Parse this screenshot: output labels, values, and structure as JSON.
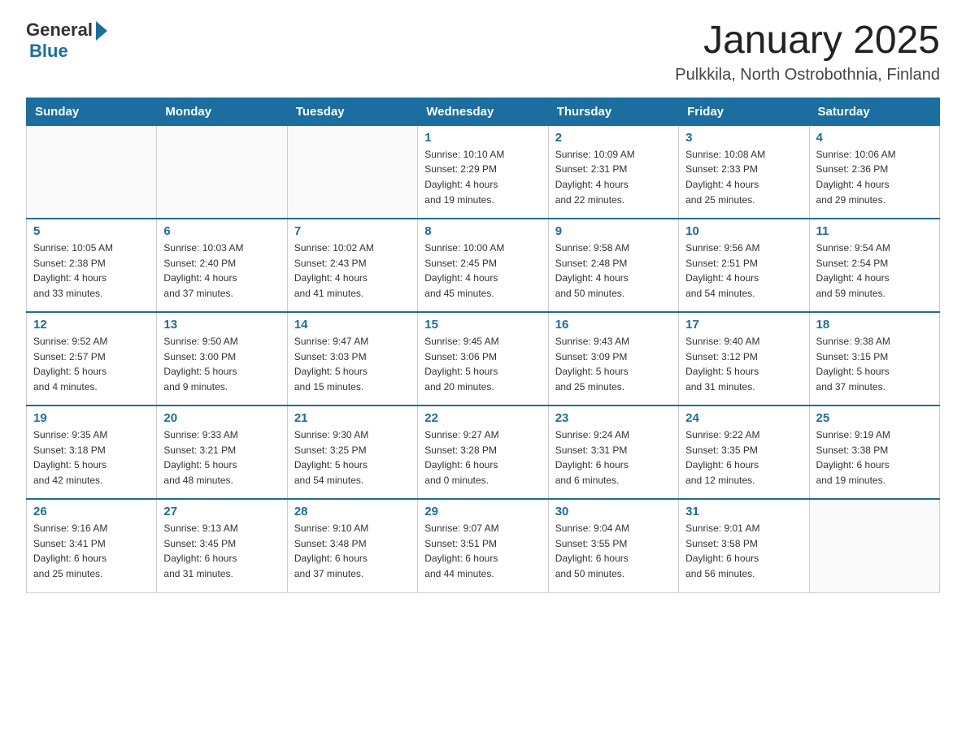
{
  "header": {
    "logo": {
      "general": "General",
      "blue": "Blue"
    },
    "title": "January 2025",
    "subtitle": "Pulkkila, North Ostrobothnia, Finland"
  },
  "weekdays": [
    "Sunday",
    "Monday",
    "Tuesday",
    "Wednesday",
    "Thursday",
    "Friday",
    "Saturday"
  ],
  "weeks": [
    [
      {
        "day": "",
        "info": ""
      },
      {
        "day": "",
        "info": ""
      },
      {
        "day": "",
        "info": ""
      },
      {
        "day": "1",
        "info": "Sunrise: 10:10 AM\nSunset: 2:29 PM\nDaylight: 4 hours\nand 19 minutes."
      },
      {
        "day": "2",
        "info": "Sunrise: 10:09 AM\nSunset: 2:31 PM\nDaylight: 4 hours\nand 22 minutes."
      },
      {
        "day": "3",
        "info": "Sunrise: 10:08 AM\nSunset: 2:33 PM\nDaylight: 4 hours\nand 25 minutes."
      },
      {
        "day": "4",
        "info": "Sunrise: 10:06 AM\nSunset: 2:36 PM\nDaylight: 4 hours\nand 29 minutes."
      }
    ],
    [
      {
        "day": "5",
        "info": "Sunrise: 10:05 AM\nSunset: 2:38 PM\nDaylight: 4 hours\nand 33 minutes."
      },
      {
        "day": "6",
        "info": "Sunrise: 10:03 AM\nSunset: 2:40 PM\nDaylight: 4 hours\nand 37 minutes."
      },
      {
        "day": "7",
        "info": "Sunrise: 10:02 AM\nSunset: 2:43 PM\nDaylight: 4 hours\nand 41 minutes."
      },
      {
        "day": "8",
        "info": "Sunrise: 10:00 AM\nSunset: 2:45 PM\nDaylight: 4 hours\nand 45 minutes."
      },
      {
        "day": "9",
        "info": "Sunrise: 9:58 AM\nSunset: 2:48 PM\nDaylight: 4 hours\nand 50 minutes."
      },
      {
        "day": "10",
        "info": "Sunrise: 9:56 AM\nSunset: 2:51 PM\nDaylight: 4 hours\nand 54 minutes."
      },
      {
        "day": "11",
        "info": "Sunrise: 9:54 AM\nSunset: 2:54 PM\nDaylight: 4 hours\nand 59 minutes."
      }
    ],
    [
      {
        "day": "12",
        "info": "Sunrise: 9:52 AM\nSunset: 2:57 PM\nDaylight: 5 hours\nand 4 minutes."
      },
      {
        "day": "13",
        "info": "Sunrise: 9:50 AM\nSunset: 3:00 PM\nDaylight: 5 hours\nand 9 minutes."
      },
      {
        "day": "14",
        "info": "Sunrise: 9:47 AM\nSunset: 3:03 PM\nDaylight: 5 hours\nand 15 minutes."
      },
      {
        "day": "15",
        "info": "Sunrise: 9:45 AM\nSunset: 3:06 PM\nDaylight: 5 hours\nand 20 minutes."
      },
      {
        "day": "16",
        "info": "Sunrise: 9:43 AM\nSunset: 3:09 PM\nDaylight: 5 hours\nand 25 minutes."
      },
      {
        "day": "17",
        "info": "Sunrise: 9:40 AM\nSunset: 3:12 PM\nDaylight: 5 hours\nand 31 minutes."
      },
      {
        "day": "18",
        "info": "Sunrise: 9:38 AM\nSunset: 3:15 PM\nDaylight: 5 hours\nand 37 minutes."
      }
    ],
    [
      {
        "day": "19",
        "info": "Sunrise: 9:35 AM\nSunset: 3:18 PM\nDaylight: 5 hours\nand 42 minutes."
      },
      {
        "day": "20",
        "info": "Sunrise: 9:33 AM\nSunset: 3:21 PM\nDaylight: 5 hours\nand 48 minutes."
      },
      {
        "day": "21",
        "info": "Sunrise: 9:30 AM\nSunset: 3:25 PM\nDaylight: 5 hours\nand 54 minutes."
      },
      {
        "day": "22",
        "info": "Sunrise: 9:27 AM\nSunset: 3:28 PM\nDaylight: 6 hours\nand 0 minutes."
      },
      {
        "day": "23",
        "info": "Sunrise: 9:24 AM\nSunset: 3:31 PM\nDaylight: 6 hours\nand 6 minutes."
      },
      {
        "day": "24",
        "info": "Sunrise: 9:22 AM\nSunset: 3:35 PM\nDaylight: 6 hours\nand 12 minutes."
      },
      {
        "day": "25",
        "info": "Sunrise: 9:19 AM\nSunset: 3:38 PM\nDaylight: 6 hours\nand 19 minutes."
      }
    ],
    [
      {
        "day": "26",
        "info": "Sunrise: 9:16 AM\nSunset: 3:41 PM\nDaylight: 6 hours\nand 25 minutes."
      },
      {
        "day": "27",
        "info": "Sunrise: 9:13 AM\nSunset: 3:45 PM\nDaylight: 6 hours\nand 31 minutes."
      },
      {
        "day": "28",
        "info": "Sunrise: 9:10 AM\nSunset: 3:48 PM\nDaylight: 6 hours\nand 37 minutes."
      },
      {
        "day": "29",
        "info": "Sunrise: 9:07 AM\nSunset: 3:51 PM\nDaylight: 6 hours\nand 44 minutes."
      },
      {
        "day": "30",
        "info": "Sunrise: 9:04 AM\nSunset: 3:55 PM\nDaylight: 6 hours\nand 50 minutes."
      },
      {
        "day": "31",
        "info": "Sunrise: 9:01 AM\nSunset: 3:58 PM\nDaylight: 6 hours\nand 56 minutes."
      },
      {
        "day": "",
        "info": ""
      }
    ]
  ]
}
